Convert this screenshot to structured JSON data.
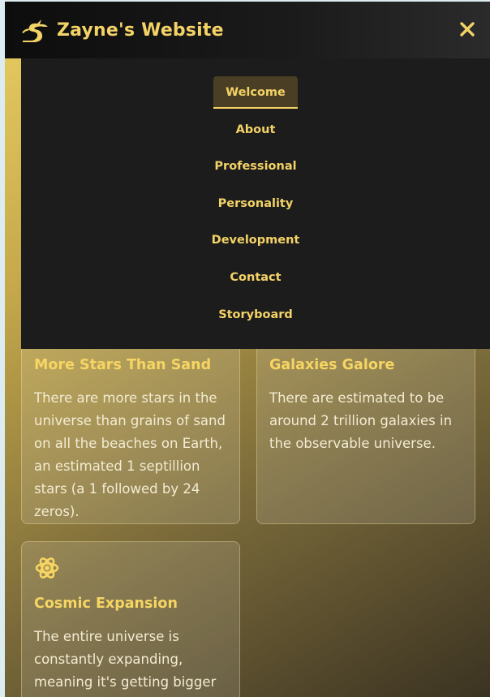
{
  "header": {
    "title": "Zayne's Website",
    "logo_icon": "dragon-logo-icon",
    "close_icon": "close-icon"
  },
  "nav": {
    "items": [
      {
        "label": "Welcome",
        "active": true
      },
      {
        "label": "About",
        "active": false
      },
      {
        "label": "Professional",
        "active": false
      },
      {
        "label": "Personality",
        "active": false
      },
      {
        "label": "Development",
        "active": false
      },
      {
        "label": "Contact",
        "active": false
      },
      {
        "label": "Storyboard",
        "active": false
      }
    ]
  },
  "cards": [
    {
      "title": "More Stars Than Sand",
      "text": "There are more stars in the universe than grains of sand on all the beaches on Earth, an estimated 1 septillion stars (a 1 followed by 24 zeros)."
    },
    {
      "title": "Galaxies Galore",
      "text": "There are estimated to be around 2 trillion galaxies in the observable universe."
    },
    {
      "title": "Cosmic Expansion",
      "icon": "atom-icon",
      "text": "The entire universe is constantly expanding, meaning it's getting bigger"
    }
  ],
  "colors": {
    "accent": "#f3d266",
    "header_bg": "#141414",
    "menu_bg": "#1c1c1c",
    "active_bg": "#4a3f25"
  }
}
